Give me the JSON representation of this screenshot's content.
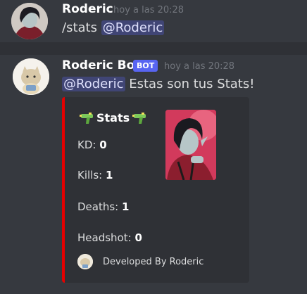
{
  "messages": [
    {
      "username": "Roderic",
      "timestamp": "hoy a las 20:28",
      "command": "/stats",
      "mention": "@Roderic"
    },
    {
      "username": "Roderic Bot",
      "bot_tag": "BOT",
      "timestamp": "hoy a las 20:28",
      "mention": "@Roderic",
      "text": "Estas son tus Stats!"
    }
  ],
  "embed": {
    "title": "Stats",
    "accent_color": "#e60000",
    "icons": [
      "water-gun-icon",
      "water-gun-icon"
    ],
    "fields": [
      {
        "label": "KD:",
        "value": "0"
      },
      {
        "label": "Kills:",
        "value": "1"
      },
      {
        "label": "Deaths:",
        "value": "1"
      },
      {
        "label": "Headshot:",
        "value": "0"
      }
    ],
    "footer": "Developed By Roderic"
  },
  "colors": {
    "background": "#36393f",
    "embed_bg": "#2f3136",
    "mention_text": "#dee0fc",
    "bot_tag": "#5865f2"
  }
}
